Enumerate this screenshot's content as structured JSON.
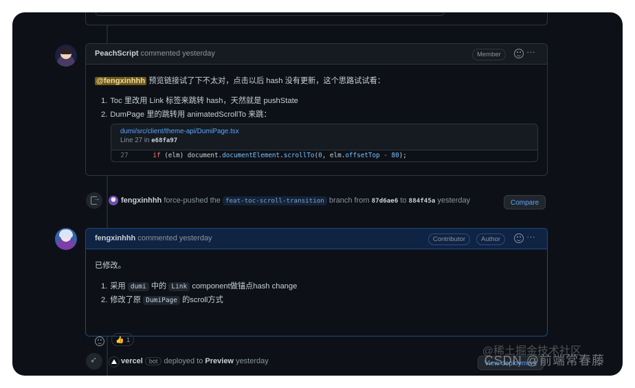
{
  "comment1": {
    "author": "PeachScript",
    "action": "commented yesterday",
    "badge": "Member",
    "mention": "@fengxinhhh",
    "text": "预览链接试了下不太对，点击以后 hash 没有更新，这个思路试试看：",
    "items": [
      {
        "num": "1.",
        "text": "Toc 里改用 Link 标签来跳转 hash，天然就是 pushState"
      },
      {
        "num": "2.",
        "text": "DumPage 里的跳转用 animatedScrollTo 来跳："
      }
    ],
    "snippet": {
      "path": "dumi/src/client/theme-api/DumiPage.tsx",
      "line_prefix": "Line 27 in",
      "sha": "e68fa97",
      "line_no": "27",
      "code_kw": "if",
      "code_a": " (elm) document.",
      "code_prop1": "documentElement",
      "code_b": ".",
      "code_prop2": "scrollTo",
      "code_c": "(",
      "code_num1": "0",
      "code_d": ", elm.",
      "code_prop3": "offsetTop",
      "code_e": " - ",
      "code_num2": "80",
      "code_f": ");"
    }
  },
  "push_event": {
    "author": "fengxinhhh",
    "action": "force-pushed the",
    "branch": "feat-toc-scroll-transition",
    "from_text": "branch from",
    "from_sha": "87d6ae6",
    "to_text": "to",
    "to_sha": "884f45a",
    "when": "yesterday",
    "button": "Compare"
  },
  "comment2": {
    "author": "fengxinhhh",
    "action": "commented yesterday",
    "badge1": "Contributor",
    "badge2": "Author",
    "text": "已修改。",
    "item1": {
      "num": "1.",
      "pre": "采用",
      "code1": "dumi",
      "mid": "中的",
      "code2": "Link",
      "post": "component做锚点hash change"
    },
    "item2": {
      "num": "2.",
      "pre": "修改了原",
      "code1": "DumiPage",
      "post": "的scroll方式"
    },
    "reaction": {
      "emoji": "👍",
      "count": "1"
    }
  },
  "deploy_event": {
    "author": "vercel",
    "bot": "bot",
    "action": "deployed to",
    "target": "Preview",
    "when": "yesterday",
    "button": "View deployment"
  },
  "watermark": {
    "line1": "@稀土掘金技术社区",
    "line2": "CSDN @前端常春藤"
  },
  "icons": [
    "emoji-icon",
    "more-icon",
    "push-icon",
    "rocket-icon",
    "thumbs-up-icon",
    "vercel-logo-icon"
  ]
}
